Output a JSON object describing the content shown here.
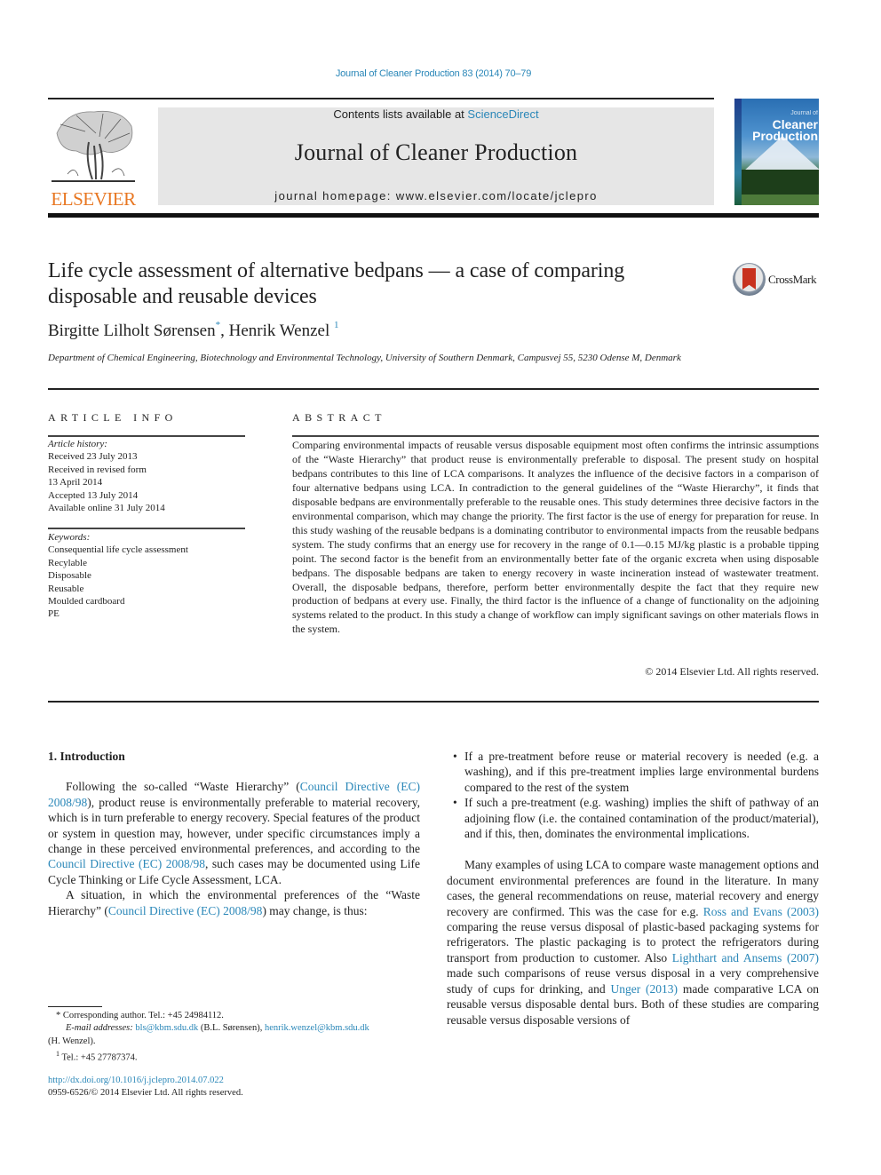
{
  "citation": "Journal of Cleaner Production 83 (2014) 70–79",
  "header": {
    "publisher_logo_text": "ELSEVIER",
    "contents_prefix": "Contents lists available at ",
    "contents_link": "ScienceDirect",
    "journal_name": "Journal of Cleaner Production",
    "homepage_prefix": "journal homepage: ",
    "homepage_url": "www.elsevier.com/locate/jclepro",
    "cover": {
      "small_title": "Journal of",
      "title_line1": "Cleaner",
      "title_line2": "Production"
    },
    "crossmark_label": "CrossMark"
  },
  "article": {
    "title": "Life cycle assessment of alternative bedpans — a case of comparing disposable and reusable devices",
    "authors": [
      {
        "name": "Birgitte Lilholt Sørensen",
        "mark": "*"
      },
      {
        "name": "Henrik Wenzel",
        "mark": "1"
      }
    ],
    "author_separator": ", ",
    "affiliation": "Department of Chemical Engineering, Biotechnology and Environmental Technology, University of Southern Denmark, Campusvej 55, 5230 Odense M, Denmark"
  },
  "article_info": {
    "heading": "ARTICLE INFO",
    "history_label": "Article history:",
    "history": [
      "Received 23 July 2013",
      "Received in revised form",
      "13 April 2014",
      "Accepted 13 July 2014",
      "Available online 31 July 2014"
    ],
    "keywords_label": "Keywords:",
    "keywords": [
      "Consequential life cycle assessment",
      "Recylable",
      "Disposable",
      "Reusable",
      "Moulded cardboard",
      "PE"
    ]
  },
  "abstract": {
    "heading": "ABSTRACT",
    "text": "Comparing environmental impacts of reusable versus disposable equipment most often confirms the intrinsic assumptions of the “Waste Hierarchy” that product reuse is environmentally preferable to disposal. The present study on hospital bedpans contributes to this line of LCA comparisons. It analyzes the influence of the decisive factors in a comparison of four alternative bedpans using LCA. In contradiction to the general guidelines of the “Waste Hierarchy”, it finds that disposable bedpans are environmentally preferable to the reusable ones. This study determines three decisive factors in the environmental comparison, which may change the priority. The first factor is the use of energy for preparation for reuse. In this study washing of the reusable bedpans is a dominating contributor to environmental impacts from the reusable bedpans system. The study confirms that an energy use for recovery in the range of 0.1—0.15 MJ/kg plastic is a probable tipping point. The second factor is the benefit from an environmentally better fate of the organic excreta when using disposable bedpans. The disposable bedpans are taken to energy recovery in waste incineration instead of wastewater treatment. Overall, the disposable bedpans, therefore, perform better environmentally despite the fact that they require new production of bedpans at every use. Finally, the third factor is the influence of a change of functionality on the adjoining systems related to the product. In this study a change of workflow can imply significant savings on other materials flows in the system.",
    "copyright": "© 2014 Elsevier Ltd. All rights reserved."
  },
  "body": {
    "section_heading": "1.  Introduction",
    "intro_p1": [
      {
        "t": "Following the so-called “Waste Hierarchy” ("
      },
      {
        "t": "Council Directive (EC) 2008/98",
        "link": true
      },
      {
        "t": "), product reuse is environmentally preferable to material recovery, which is in turn preferable to energy recovery. Special features of the product or system in question may, however, under specific circumstances imply a change in these perceived environmental preferences, and according to the "
      },
      {
        "t": "Council Directive (EC) 2008/98",
        "link": true
      },
      {
        "t": ", such cases may be documented using Life Cycle Thinking or Life Cycle Assessment, LCA."
      }
    ],
    "intro_p2": [
      {
        "t": "A situation, in which the environmental preferences of the “Waste Hierarchy” ("
      },
      {
        "t": "Council Directive (EC) 2008/98",
        "link": true
      },
      {
        "t": ") may change, is thus:"
      }
    ],
    "bullets": [
      "If a pre-treatment before reuse or material recovery is needed (e.g. a washing), and if this pre-treatment implies large environmental burdens compared to the rest of the system",
      "If such a pre-treatment (e.g. washing) implies the shift of pathway of an adjoining flow (i.e. the contained contamination of the product/material), and if this, then, dominates the environmental implications."
    ],
    "right_p1": [
      {
        "t": "Many examples of using LCA to compare waste management options and document environmental preferences are found in the literature. In many cases, the general recommendations on reuse, material recovery and energy recovery are confirmed. This was the case for e.g. "
      },
      {
        "t": "Ross and Evans (2003)",
        "link": true
      },
      {
        "t": " comparing the reuse versus disposal of plastic-based packaging systems for refrigerators. The plastic packaging is to protect the refrigerators during transport from production to customer. Also "
      },
      {
        "t": "Lighthart and Ansems (2007)",
        "link": true
      },
      {
        "t": " made such comparisons of reuse versus disposal in a very comprehensive study of cups for drinking, and "
      },
      {
        "t": "Unger (2013)",
        "link": true
      },
      {
        "t": " made comparative LCA on reusable versus disposable dental burs. Both of these studies are comparing reusable versus disposable versions of"
      }
    ]
  },
  "footnotes": {
    "corresponding_mark": "*",
    "corresponding": "Corresponding author. Tel.: +45 24984112.",
    "email_label": "E-mail addresses:",
    "email1": "bls@kbm.sdu.dk",
    "email1_name": " (B.L. Sørensen), ",
    "email2": "henrik.wenzel@kbm.sdu.dk",
    "email2_name": "(H. Wenzel).",
    "note1_mark": "1",
    "note1": "Tel.: +45 27787374.",
    "doi": "http://dx.doi.org/10.1016/j.jclepro.2014.07.022",
    "issn": "0959-6526/© 2014 Elsevier Ltd. All rights reserved."
  }
}
